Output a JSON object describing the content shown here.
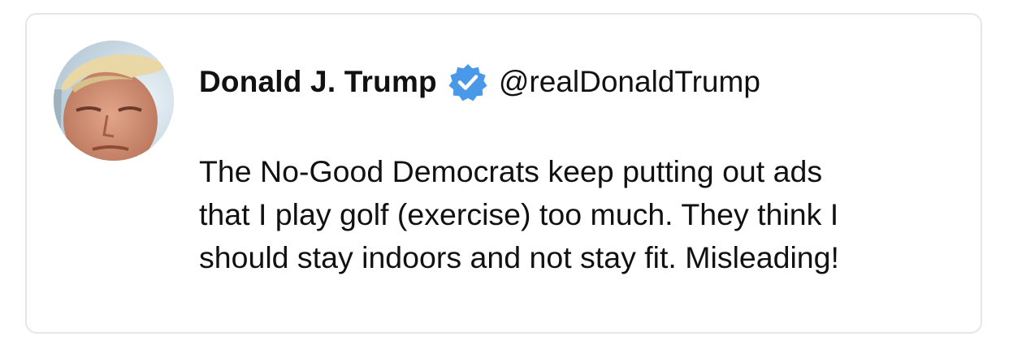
{
  "tweet": {
    "author": {
      "display_name": "Donald J. Trump",
      "handle": "@realDonaldTrump",
      "verified": true,
      "avatar_icon": "profile-photo"
    },
    "text_lines": [
      "The No-Good Democrats keep putting out ads",
      "that I play golf (exercise) too much. They think I",
      "should stay indoors and not stay fit. Misleading!"
    ]
  },
  "colors": {
    "verified_badge": "#4a99e9",
    "text": "#111111",
    "card_border": "#e6e6e6"
  }
}
